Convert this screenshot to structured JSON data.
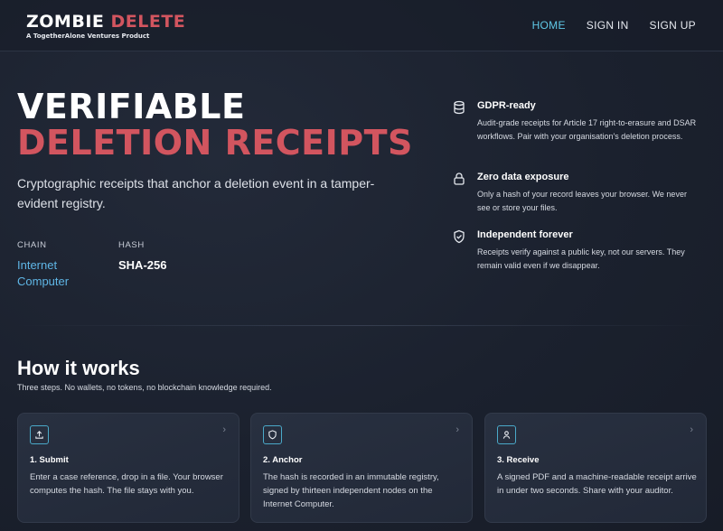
{
  "header": {
    "logo_part1": "ZOMBIE",
    "logo_part2": "DELETE",
    "logo_tagline": "A TogetherAlone Ventures Product",
    "nav": [
      {
        "label": "HOME",
        "active": true
      },
      {
        "label": "SIGN IN",
        "active": false
      },
      {
        "label": "SIGN UP",
        "active": false
      }
    ]
  },
  "hero": {
    "title_line1": "VERIFIABLE",
    "title_line2": "DELETION RECEIPTS",
    "description": "Cryptographic receipts that anchor a deletion event in a tamper-evident registry.",
    "chain_label": "CHAIN",
    "chain_value": "Internet Computer",
    "hash_label": "HASH",
    "hash_value": "SHA-256"
  },
  "features": [
    {
      "icon": "database-icon",
      "title": "GDPR-ready",
      "description": "Audit-grade receipts for Article 17 right-to-erasure and DSAR workflows. Pair with your organisation's deletion process."
    },
    {
      "icon": "lock-icon",
      "title": "Zero data exposure",
      "description": "Only a hash of your record leaves your browser. We never see or store your files."
    },
    {
      "icon": "shield-check-icon",
      "title": "Independent forever",
      "description": "Receipts verify against a public key, not our servers. They remain valid even if we disappear."
    }
  ],
  "how": {
    "title": "How it works",
    "subtitle": "Three steps. No wallets, no tokens, no blockchain knowledge required.",
    "steps": [
      {
        "icon": "upload-icon",
        "title": "1. Submit",
        "description": "Enter a case reference, drop in a file. Your browser computes the hash. The file stays with you."
      },
      {
        "icon": "shield-icon",
        "title": "2. Anchor",
        "description": "The hash is recorded in an immutable registry, signed by thirteen independent nodes on the Internet Computer."
      },
      {
        "icon": "user-icon",
        "title": "3. Receive",
        "description": "A signed PDF and a machine-readable receipt arrive in under two seconds. Share with your auditor."
      }
    ]
  },
  "colors": {
    "accent_red": "#d2555f",
    "accent_cyan": "#5fc8e6",
    "background": "#1b212e"
  }
}
